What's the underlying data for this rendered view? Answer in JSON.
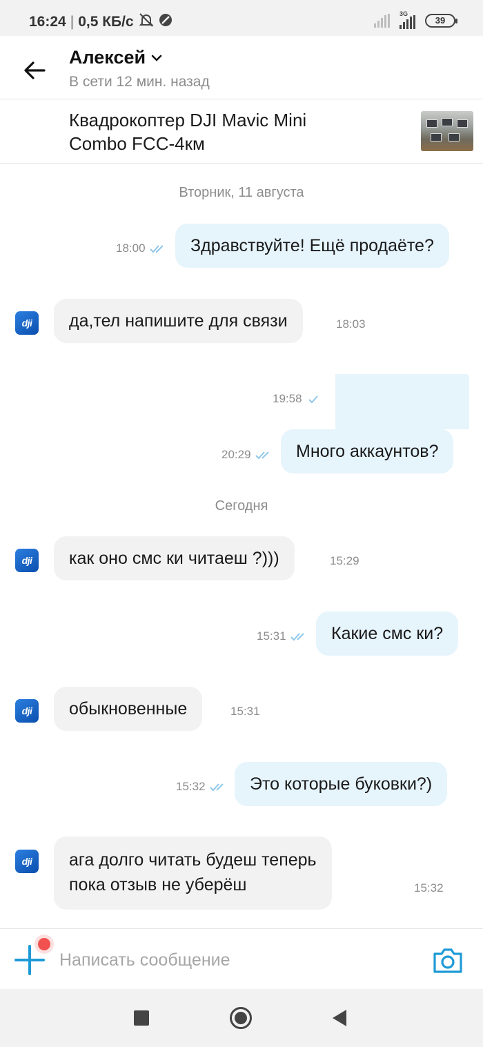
{
  "status_bar": {
    "time": "16:24",
    "speed": "0,5 КБ/с",
    "network_type": "3G",
    "battery": "39",
    "icons": [
      "mute-bell-icon",
      "no-disturb-icon",
      "signal-weak-icon",
      "signal-strong-icon",
      "battery-icon"
    ]
  },
  "header": {
    "contact_name": "Алексей",
    "contact_status": "В сети 12 мин. назад",
    "icons": [
      "back-arrow-icon",
      "chevron-down-icon"
    ]
  },
  "product": {
    "title_line1": "Квадрокоптер DJI Mavic Mini",
    "title_line2": "Combo FCC-4км"
  },
  "chat": {
    "date_1": "Вторник, 11 августа",
    "date_2": "Сегодня",
    "messages": [
      {
        "direction": "out",
        "text": "Здравствуйте! Ещё продаёте?",
        "time": "18:00"
      },
      {
        "direction": "in",
        "text": "да,тел напишите для связи",
        "time": "18:03"
      },
      {
        "direction": "out",
        "text": "",
        "time": "19:58"
      },
      {
        "direction": "out",
        "text": "Много аккаунтов?",
        "time": "20:29"
      },
      {
        "direction": "in",
        "text": "как оно смс ки читаеш ?)))",
        "time": "15:29"
      },
      {
        "direction": "out",
        "text": "Какие смс ки?",
        "time": "15:31"
      },
      {
        "direction": "in",
        "text": "обыкновенные",
        "time": "15:31"
      },
      {
        "direction": "out",
        "text": "Это которые буковки?)",
        "time": "15:32"
      },
      {
        "direction": "in",
        "text_line1": "ага долго читать будеш теперь",
        "text_line2": "пока отзыв не уберёш",
        "time": "15:32"
      }
    ],
    "avatar_label": "dji"
  },
  "input": {
    "placeholder": "Написать сообщение",
    "value": ""
  },
  "colors": {
    "accent": "#1e9ad6",
    "outgoing_bubble": "#e6f4fc",
    "incoming_bubble": "#f2f2f2",
    "notification_dot": "#f1524f",
    "read_ticks": "#8fc7ea"
  }
}
